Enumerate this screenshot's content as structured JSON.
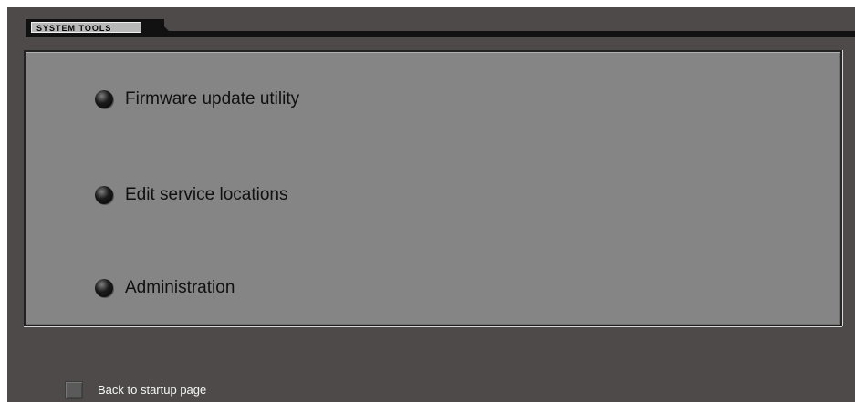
{
  "window": {
    "tab_label": "SYSTEM TOOLS"
  },
  "menu": {
    "items": [
      {
        "label": "Firmware update utility",
        "icon": "radio-bullet-icon"
      },
      {
        "label": "Edit service locations",
        "icon": "radio-bullet-icon"
      },
      {
        "label": "Administration",
        "icon": "radio-bullet-icon"
      }
    ]
  },
  "footer": {
    "back_label": "Back to startup page"
  },
  "colors": {
    "background": "#4f4a4a",
    "panel": "#858585",
    "text_dark": "#101010",
    "text_light": "#f7f7f7",
    "tab_face": "#b8b8b8"
  }
}
